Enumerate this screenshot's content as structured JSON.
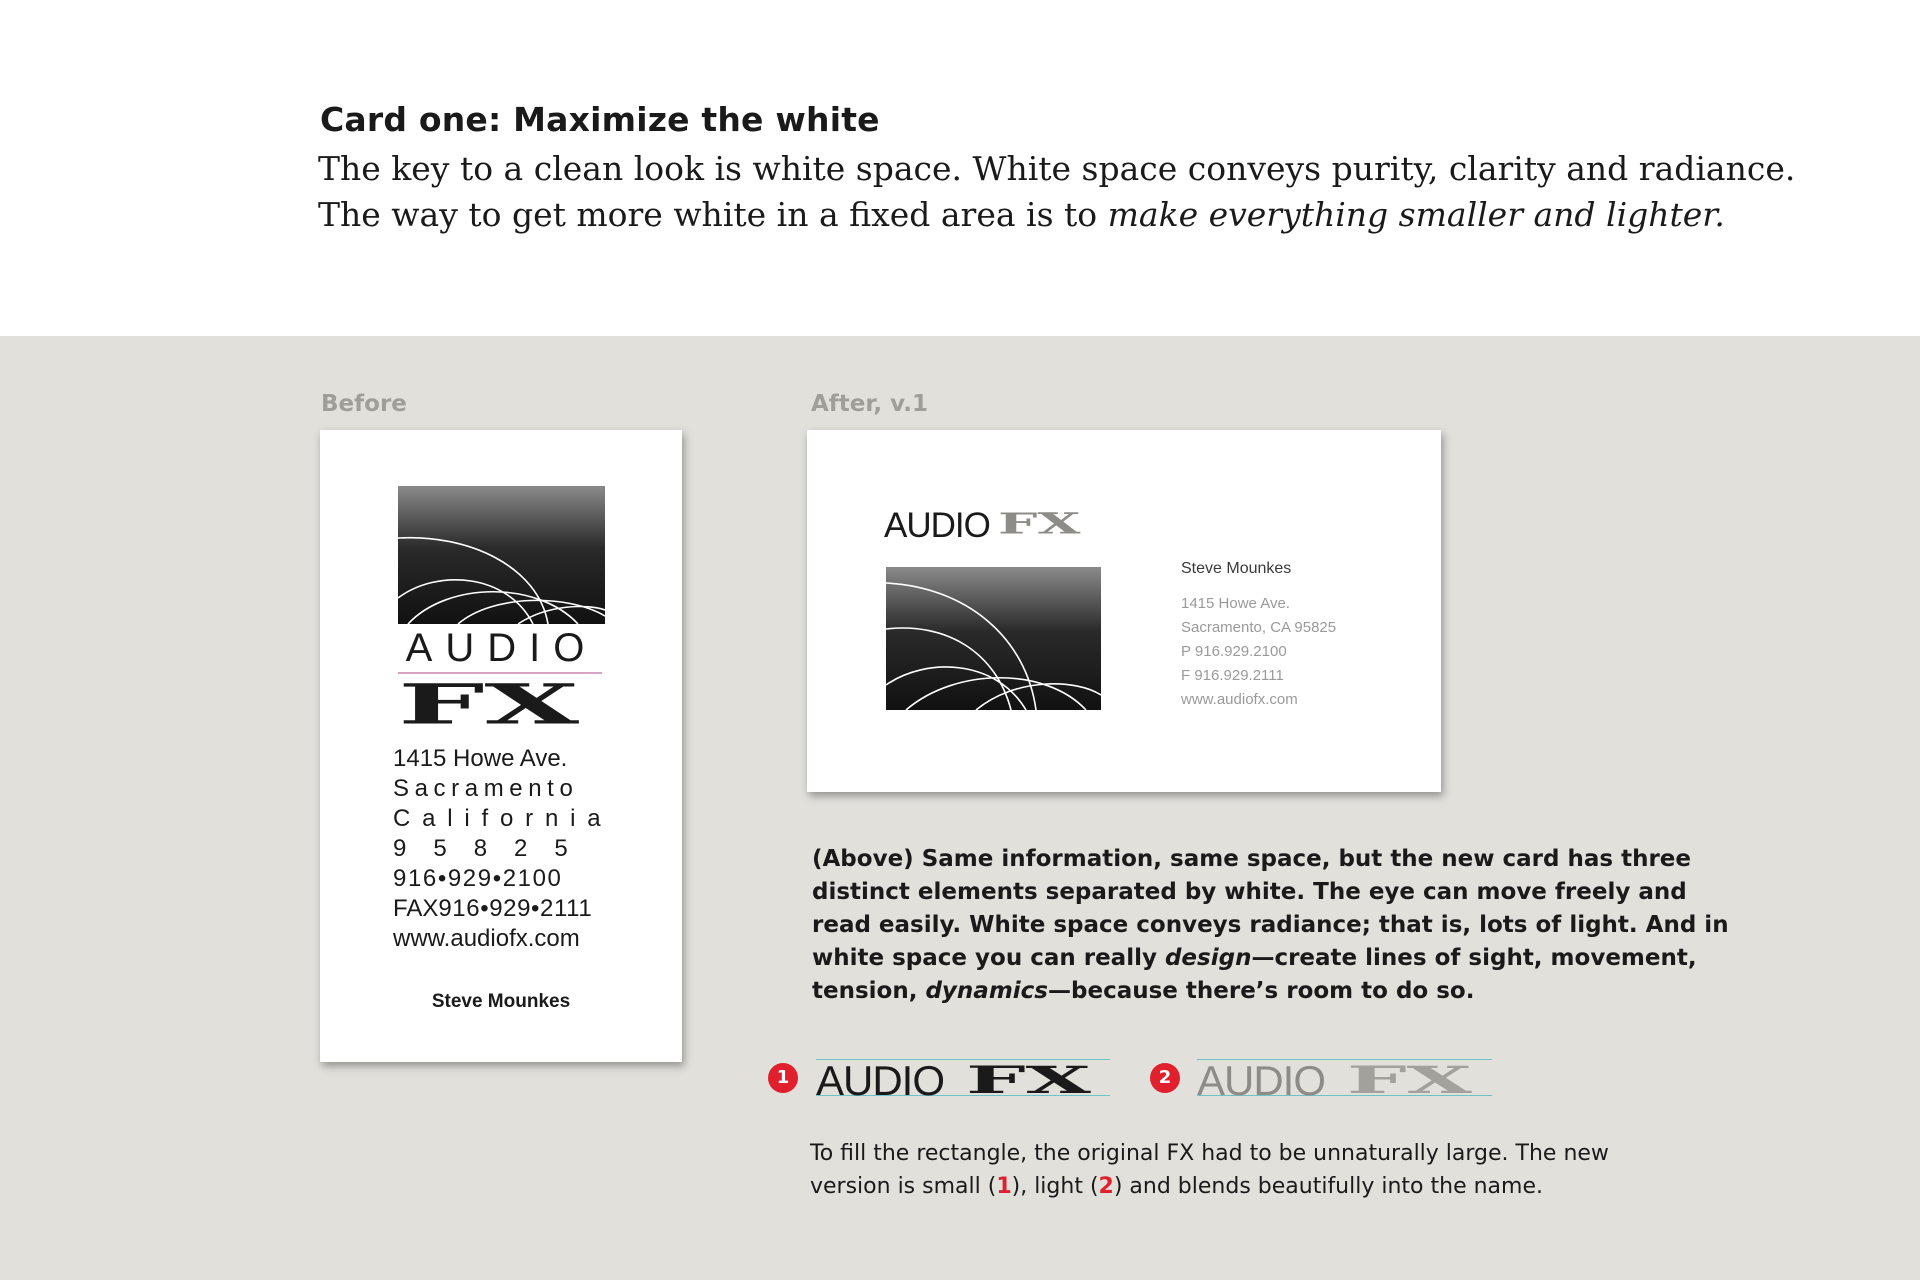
{
  "heading": "Card one: Maximize the white",
  "intro": {
    "line1": "The key to a clean look is white space. White space conveys purity, clarity and radiance.",
    "line2_plain": "The way to get more white in a fixed area is to ",
    "line2_italic": "make everything smaller and lighter."
  },
  "before": {
    "label": "Before",
    "logo_audio": "AUDIO",
    "logo_fx": "FX",
    "address": "1415 Howe Ave.",
    "city": "Sacramento",
    "state": "California",
    "zip": "95825",
    "phone": "916•929•2100",
    "fax_prefix": "FAX",
    "fax": "916•929•2111",
    "web": "www.audiofx.com",
    "name": "Steve Mounkes"
  },
  "after": {
    "label": "After, v.1",
    "logo_audio": "AUDIO",
    "logo_fx": "FX",
    "name": "Steve Mounkes",
    "address": "1415 Howe Ave.",
    "city_line": "Sacramento, CA 95825",
    "phone": "P 916.929.2100",
    "fax": "F 916.929.2111",
    "web": "www.audiofx.com"
  },
  "caption_above": {
    "line1": "(Above) Same information, same space, but the new card has three",
    "line2": "distinct elements separated by white. The eye can move freely and",
    "line3": "read easily. White space conveys radiance; that is, lots of light. And in",
    "line4_a": "white space you can really ",
    "line4_em": "design",
    "line4_b": "—create lines of sight, movement,",
    "line5_a": "tension, ",
    "line5_em": "dynamics",
    "line5_b": "—because there’s room to do so."
  },
  "variants": [
    {
      "badge": "1",
      "audio": "AUDIO",
      "fx": "FX",
      "fx_color": "#1a1a1a"
    },
    {
      "badge": "2",
      "audio": "AUDIO",
      "fx": "FX",
      "fx_color": "#a3a19c"
    }
  ],
  "caption_below": {
    "line1": "To fill the rectangle, the original FX had to be unnaturally large. The new",
    "line2_a": "version is small (",
    "line2_n1": "1",
    "line2_b": "), light (",
    "line2_n2": "2",
    "line2_c": ") and blends beautifully into the name."
  },
  "colors": {
    "background_gray": "#e1e0db",
    "badge_red": "#e0202c",
    "accent_pink": "#d9a3c4",
    "rule_teal": "#6fc1c9"
  }
}
